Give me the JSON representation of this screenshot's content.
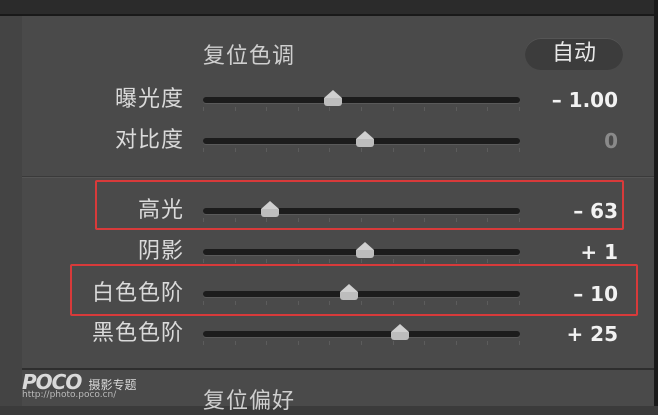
{
  "tone_section": {
    "reset_label": "复位色调",
    "auto_label": "自动"
  },
  "sliders": [
    {
      "label": "曝光度",
      "value": "– 1.00",
      "position": 0.41,
      "highlighted": false,
      "dim": false
    },
    {
      "label": "对比度",
      "value": "0",
      "position": 0.51,
      "highlighted": false,
      "dim": true
    },
    {
      "label": "高光",
      "value": "– 63",
      "position": 0.21,
      "highlighted": true,
      "dim": false
    },
    {
      "label": "阴影",
      "value": "+ 1",
      "position": 0.51,
      "highlighted": false,
      "dim": false
    },
    {
      "label": "白色色阶",
      "value": "– 10",
      "position": 0.46,
      "highlighted": true,
      "dim": false
    },
    {
      "label": "黑色色阶",
      "value": "+ 25",
      "position": 0.62,
      "highlighted": false,
      "dim": false
    }
  ],
  "next_section": {
    "reset_label": "复位偏好"
  },
  "watermark": {
    "logo": "POCO",
    "text": "摄影专题",
    "url": "http://photo.poco.cn/"
  },
  "colors": {
    "panel_bg": "#4a4a4a",
    "highlight_border": "#d83a3a",
    "text": "#dadada"
  }
}
